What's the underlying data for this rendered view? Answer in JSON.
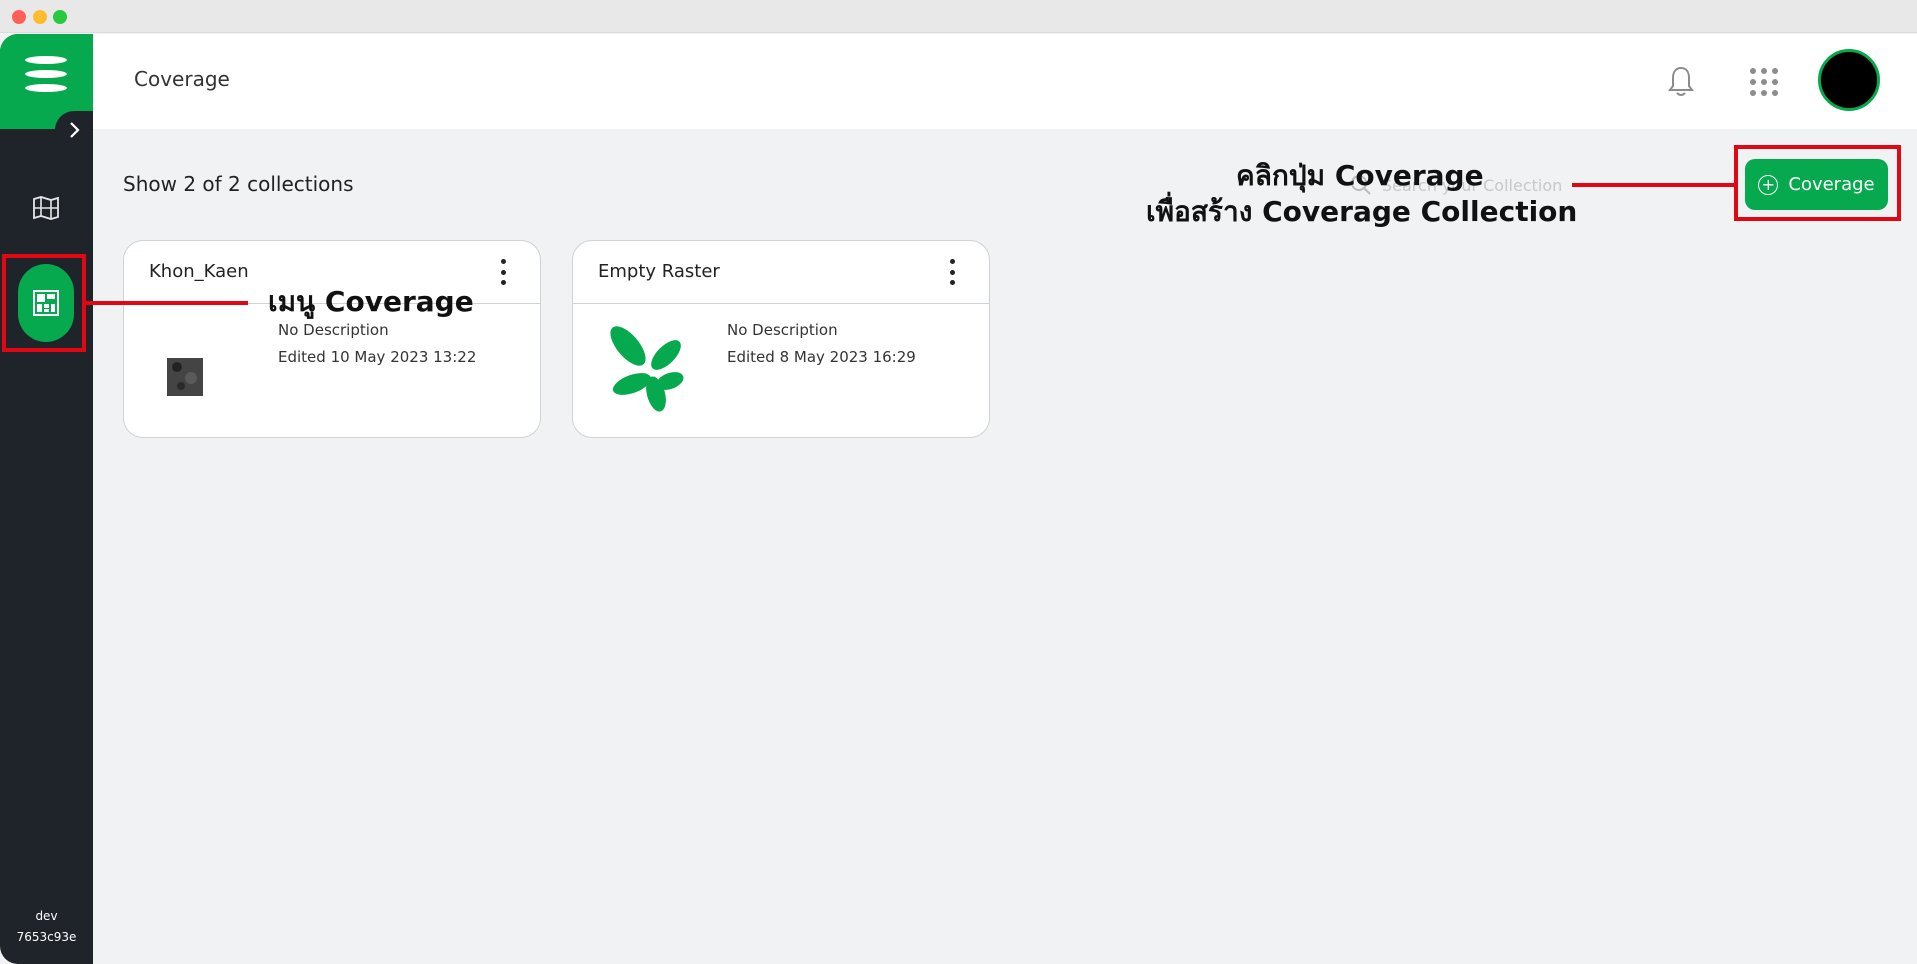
{
  "app": {
    "page_title": "Coverage",
    "collections_count": "Show 2 of 2 collections",
    "add_button_label": "Coverage",
    "search_placeholder": "Search your Collection",
    "build_label": "dev",
    "build_hash": "7653c93e",
    "accent_color": "#06a94d",
    "sidebar_color": "#1f242b"
  },
  "icons": {
    "brand": "brand-logo-icon",
    "expand": "chevron-right-icon",
    "map": "map-icon",
    "coverage": "coverage-grid-icon",
    "notifications": "bell-icon",
    "apps": "apps-grid-icon",
    "search": "search-icon",
    "add": "plus-circle-icon",
    "menu": "more-vertical-icon"
  },
  "collections": [
    {
      "title": "Khon_Kaen",
      "description": "No Description",
      "edited": "Edited 10 May 2023 13:22"
    },
    {
      "title": "Empty Raster",
      "description": "No Description",
      "edited": "Edited 8 May 2023 16:29"
    }
  ],
  "annotations": {
    "menu_note": "เมนู Coverage",
    "button_note_line1": "คลิกปุ่ม Coverage",
    "button_note_line2": "เพื่อสร้าง Coverage Collection",
    "highlight_color": "#e30613"
  }
}
